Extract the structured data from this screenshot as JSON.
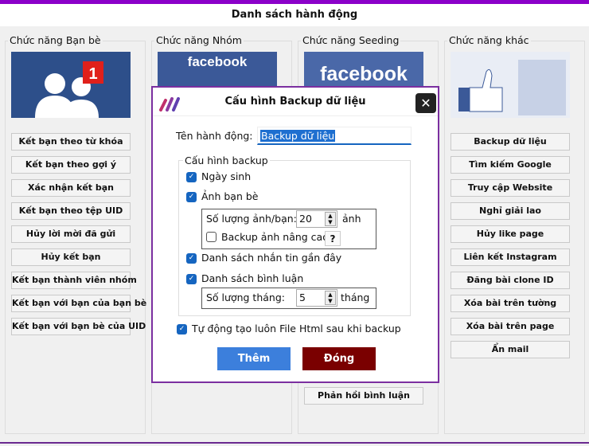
{
  "header": {
    "title": "Danh sách hành động"
  },
  "groups": {
    "friends": {
      "label": "Chức năng Bạn bè",
      "badge": "1",
      "buttons": [
        "Kết bạn theo từ khóa",
        "Kết bạn theo gợi ý",
        "Xác nhận kết bạn",
        "Kết bạn theo tệp UID",
        "Hủy lời mời đã gửi",
        "Hủy kết bạn",
        "Kết bạn thành viên nhóm",
        "Kết bạn với bạn của bạn bè",
        "Kết bạn với bạn bè của UID"
      ]
    },
    "groups": {
      "label": "Chức năng Nhóm",
      "logo": "facebook"
    },
    "seeding": {
      "label": "Chức năng Seeding",
      "logo": "facebook",
      "buttons": [
        "Phản hồi bình luận"
      ]
    },
    "other": {
      "label": "Chức năng khác",
      "buttons": [
        "Backup dữ liệu",
        "Tìm kiếm Google",
        "Truy cập Website",
        "Nghỉ giải lao",
        "Hủy like page",
        "Liên kết Instagram",
        "Đăng bài clone ID",
        "Xóa bài trên tường",
        "Xóa bài trên page",
        "Ẩn mail"
      ]
    }
  },
  "dialog": {
    "title": "Cấu hình Backup dữ liệu",
    "close": "✕",
    "name_label": "Tên hành động:",
    "name_value": "Backup dữ liệu",
    "group_label": "Cấu hình backup",
    "birthday": {
      "label": "Ngày sinh",
      "checked": true
    },
    "photos": {
      "label": "Ảnh bạn bè",
      "checked": true
    },
    "photos_count_label": "Số lượng ảnh/bạn:",
    "photos_count": "20",
    "photos_unit": "ảnh",
    "advanced": {
      "label": "Backup ảnh nâng cao",
      "checked": false
    },
    "help": "?",
    "messages": {
      "label": "Danh sách nhắn tin gần đây",
      "checked": true
    },
    "comments": {
      "label": "Danh sách bình luận",
      "checked": true
    },
    "months_label": "Số lượng tháng:",
    "months": "5",
    "months_unit": "tháng",
    "auto_html": {
      "label": "Tự động tạo luôn File Html sau khi backup",
      "checked": true
    },
    "add": "Thêm",
    "cancel": "Đóng",
    "colors": {
      "add": "#3c7fdc",
      "cancel": "#7a0000",
      "accent": "#7b2fa0"
    }
  }
}
